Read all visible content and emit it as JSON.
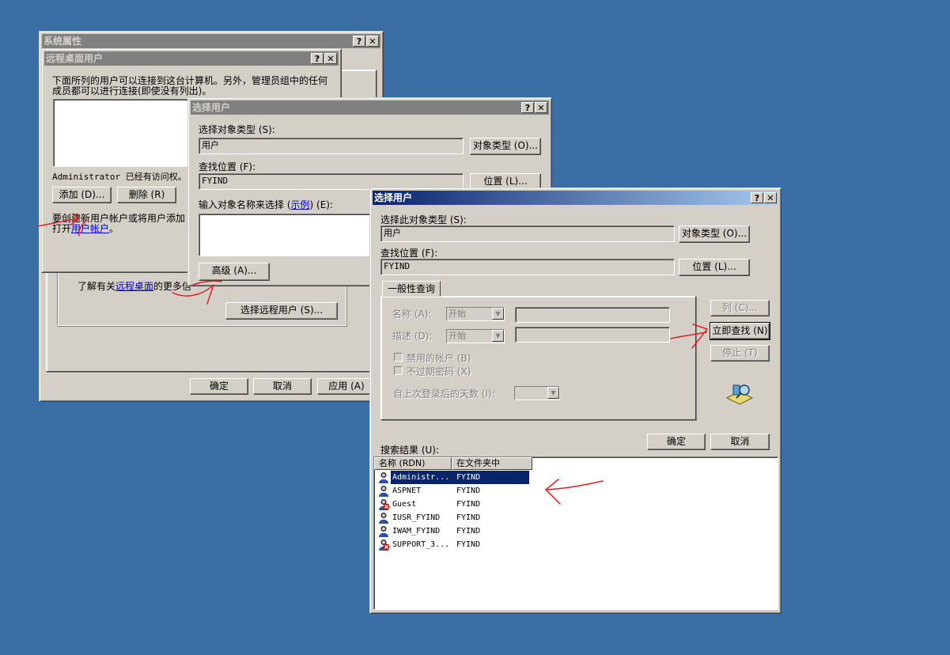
{
  "win_sysprops": {
    "title": "系统属性",
    "help": "?",
    "close": "✕",
    "info_text": "了解有关",
    "info_link": "远程桌面",
    "info_tail": "的更多信",
    "select_remote_users": "选择远程用户 (S)...",
    "ok": "确定",
    "cancel": "取消",
    "apply": "应用 (A)"
  },
  "win_remote_users": {
    "title": "远程桌面用户",
    "help": "?",
    "close": "✕",
    "desc_line1": "下面所列的用户可以连接到这台计算机。另外，管理员组中的任何",
    "desc_line2": "成员都可以进行连接(即使没有列出)。",
    "admin_text": "Administrator 已经有访问权。",
    "add": "添加 (D)...",
    "remove": "删除 (R)",
    "create_line1": "要创建新用户帐户或将用户添加",
    "create_line2": "打开",
    "create_link": "用户帐户",
    "create_end": "。"
  },
  "win_select_users_back": {
    "title": "选择用户",
    "help": "?",
    "close": "✕",
    "obj_type_label": "选择对象类型 (S):",
    "obj_type_value": "用户",
    "obj_type_btn": "对象类型 (O)...",
    "location_label": "查找位置 (F):",
    "location_value": "FYIND",
    "location_btn": "位置 (L)...",
    "names_label": "输入对象名称来选择 (",
    "names_link": "示例",
    "names_end": ") (E):",
    "advanced_btn": "高级 (A)..."
  },
  "win_select_users_front": {
    "title": "选择用户",
    "help": "?",
    "close": "✕",
    "obj_type_label": "选择此对象类型 (S):",
    "obj_type_value": "用户",
    "obj_type_btn": "对象类型 (O)...",
    "location_label": "查找位置 (F):",
    "location_value": "FYIND",
    "location_btn": "位置 (L)...",
    "tab_general": "一般性查询",
    "name_label": "名称 (A):",
    "name_combo": "开始",
    "desc_label": "描述 (D):",
    "desc_combo": "开始",
    "disabled_accounts": "禁用的帐户 (B)",
    "no_expire_pwd": "不过期密码 (X)",
    "days_since_login": "自上次登录后的天数 (I):",
    "columns_btn": "列 (C)...",
    "find_now_btn": "立即查找 (N)",
    "stop_btn": "停止 (T)",
    "ok": "确定",
    "cancel": "取消",
    "results_label": "搜索结果 (U):",
    "col_name": "名称 (RDN)",
    "col_folder": "在文件夹中",
    "rows": [
      {
        "name": "Administr...",
        "folder": "FYIND",
        "icon": "user-icon",
        "disabled": false,
        "selected": true
      },
      {
        "name": "ASPNET",
        "folder": "FYIND",
        "icon": "user-icon",
        "disabled": false,
        "selected": false
      },
      {
        "name": "Guest",
        "folder": "FYIND",
        "icon": "disabled-user-icon",
        "disabled": true,
        "selected": false
      },
      {
        "name": "IUSR_FYIND",
        "folder": "FYIND",
        "icon": "user-icon",
        "disabled": false,
        "selected": false
      },
      {
        "name": "IWAM_FYIND",
        "folder": "FYIND",
        "icon": "user-icon",
        "disabled": false,
        "selected": false
      },
      {
        "name": "SUPPORT_3...",
        "folder": "FYIND",
        "icon": "disabled-user-icon",
        "disabled": true,
        "selected": false
      }
    ]
  },
  "colors": {
    "desktop": "#3a6ea5",
    "face": "#d4d0c8",
    "active_title": "#0a246a",
    "annotation": "#e02020"
  }
}
